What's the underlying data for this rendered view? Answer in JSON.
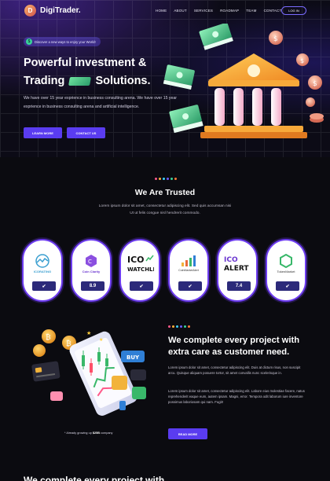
{
  "brand": {
    "logo_letter": "D",
    "name": "DigiTrader."
  },
  "nav": {
    "links": [
      "HOME",
      "ABOUT",
      "SERVICES",
      "ROADMAP",
      "TEAM",
      "CONTACT"
    ],
    "login_label": "LOG IN",
    "accent": "#7a6bff"
  },
  "hero": {
    "pill_text": "Discover a new ways to enjoy your World!",
    "title_line1": "Powerful investment &",
    "title_line2_a": "Trading",
    "title_line2_b": "Solutions.",
    "description": "We have over 15 year exprience in business consulting arena. We have over 15 year exprience in business consulting arena and artificial intelligence.",
    "learn_more_label": "LEARN MORE",
    "contact_label": "CONTACT US",
    "button_color": "#5a3cf0"
  },
  "trusted": {
    "title": "We Are Trusted",
    "description": "Lorem ipsum dolor sit amet, consectetur adipiscing elit. Sed quis accumsan nisi Ut ut felis congue nisl hendrerit commodo.",
    "partners": [
      {
        "name": "ICORATING",
        "badge": "check",
        "icon": "icorating-logo"
      },
      {
        "name": "Coin Clarity",
        "badge": "8.9",
        "icon": "coinclarity-logo"
      },
      {
        "name": "ICO WATCHLIST",
        "badge": "check",
        "icon": "icowatchlist-logo"
      },
      {
        "name": "CoinMarketAlert",
        "badge": "check",
        "icon": "coinmarketalert-logo"
      },
      {
        "name": "ICO ALERT",
        "badge": "7.4",
        "icon": "icoalert-logo"
      },
      {
        "name": "TokenMarket",
        "badge": "check",
        "icon": "tokenmarket-logo"
      }
    ]
  },
  "complete": {
    "title": "We complete every project with extra care as customer need.",
    "paragraph1": "Lorem ipsum dolor sit amet, consectetur adipiscing elit. Duis at dictum risus, non suscipit arcu. Quisque aliquam posuere tortor, sit amet convallis nunc scelerisque in.",
    "paragraph2": "Lorem ipsum dolor sit amet, consectetur adipiscing elit. Labore eius molestiae facere, natus reprehenderit eaque eum, autem ipsam. Magni, error. Tempora odit laborum iure inventore possimus laboriosam qui nam. Fugit!",
    "caption_prefix": "* Already growing up",
    "caption_value": "$25B",
    "caption_suffix": "company",
    "read_more_label": "READ MORE",
    "buy_label": "BUY"
  },
  "bottom": {
    "title_partial": "We complete every project with"
  },
  "dot_colors": [
    "#ff5a8a",
    "#ffb03b",
    "#3bd1ff",
    "#6d5cff",
    "#39d39a",
    "#ff7b3b"
  ]
}
